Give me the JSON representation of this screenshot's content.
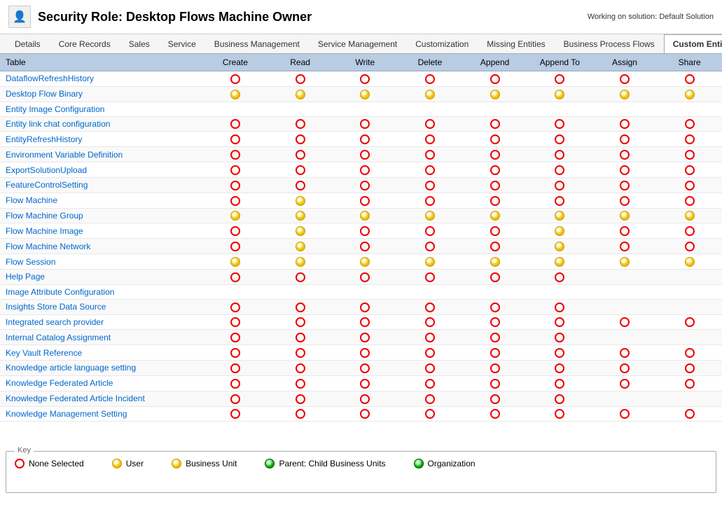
{
  "title": "Security Role: Desktop Flows Machine Owner",
  "working_on": "Working on solution: Default Solution",
  "tabs": [
    {
      "label": "Details",
      "active": false
    },
    {
      "label": "Core Records",
      "active": false
    },
    {
      "label": "Sales",
      "active": false
    },
    {
      "label": "Service",
      "active": false
    },
    {
      "label": "Business Management",
      "active": false
    },
    {
      "label": "Service Management",
      "active": false
    },
    {
      "label": "Customization",
      "active": false
    },
    {
      "label": "Missing Entities",
      "active": false
    },
    {
      "label": "Business Process Flows",
      "active": false
    },
    {
      "label": "Custom Entities",
      "active": true
    }
  ],
  "columns": [
    "Table",
    "Create",
    "Read",
    "Write",
    "Delete",
    "Append",
    "Append To",
    "Assign",
    "Share"
  ],
  "rows": [
    {
      "name": "DataflowRefreshHistory",
      "link": true,
      "cells": [
        "none",
        "none",
        "none",
        "none",
        "none",
        "none",
        "none",
        "none"
      ]
    },
    {
      "name": "Desktop Flow Binary",
      "link": true,
      "cells": [
        "user",
        "user",
        "user",
        "user",
        "user",
        "user",
        "user",
        "user"
      ]
    },
    {
      "name": "Entity Image Configuration",
      "link": true,
      "cells": [
        null,
        null,
        null,
        null,
        null,
        null,
        null,
        null
      ]
    },
    {
      "name": "Entity link chat configuration",
      "link": true,
      "cells": [
        "none",
        "none",
        "none",
        "none",
        "none",
        "none",
        "none",
        "none"
      ]
    },
    {
      "name": "EntityRefreshHistory",
      "link": true,
      "cells": [
        "none",
        "none",
        "none",
        "none",
        "none",
        "none",
        "none",
        "none"
      ]
    },
    {
      "name": "Environment Variable Definition",
      "link": true,
      "cells": [
        "none",
        "none",
        "none",
        "none",
        "none",
        "none",
        "none",
        "none"
      ]
    },
    {
      "name": "ExportSolutionUpload",
      "link": true,
      "cells": [
        "none",
        "none",
        "none",
        "none",
        "none",
        "none",
        "none",
        "none"
      ]
    },
    {
      "name": "FeatureControlSetting",
      "link": true,
      "cells": [
        "none",
        "none",
        "none",
        "none",
        "none",
        "none",
        "none",
        "none"
      ]
    },
    {
      "name": "Flow Machine",
      "link": true,
      "cells": [
        "none",
        "user",
        "none",
        "none",
        "none",
        "none",
        "none",
        "none"
      ]
    },
    {
      "name": "Flow Machine Group",
      "link": true,
      "cells": [
        "user",
        "user",
        "user",
        "user",
        "user",
        "user",
        "user",
        "user"
      ]
    },
    {
      "name": "Flow Machine Image",
      "link": true,
      "cells": [
        "none",
        "user",
        "none",
        "none",
        "none",
        "user",
        "none",
        "none"
      ]
    },
    {
      "name": "Flow Machine Network",
      "link": true,
      "cells": [
        "none",
        "user",
        "none",
        "none",
        "none",
        "user",
        "none",
        "none"
      ]
    },
    {
      "name": "Flow Session",
      "link": true,
      "cells": [
        "user",
        "user",
        "user",
        "user",
        "user",
        "user",
        "user",
        "user"
      ]
    },
    {
      "name": "Help Page",
      "link": true,
      "cells": [
        "none",
        "none",
        "none",
        "none",
        "none",
        "none",
        null,
        null
      ]
    },
    {
      "name": "Image Attribute Configuration",
      "link": true,
      "cells": [
        null,
        null,
        null,
        null,
        null,
        null,
        null,
        null
      ]
    },
    {
      "name": "Insights Store Data Source",
      "link": true,
      "cells": [
        "none",
        "none",
        "none",
        "none",
        "none",
        "none",
        null,
        null
      ]
    },
    {
      "name": "Integrated search provider",
      "link": true,
      "cells": [
        "none",
        "none",
        "none",
        "none",
        "none",
        "none",
        "none",
        "none"
      ]
    },
    {
      "name": "Internal Catalog Assignment",
      "link": true,
      "cells": [
        "none",
        "none",
        "none",
        "none",
        "none",
        "none",
        null,
        null
      ]
    },
    {
      "name": "Key Vault Reference",
      "link": true,
      "cells": [
        "none",
        "none",
        "none",
        "none",
        "none",
        "none",
        "none",
        "none"
      ]
    },
    {
      "name": "Knowledge article language setting",
      "link": true,
      "cells": [
        "none",
        "none",
        "none",
        "none",
        "none",
        "none",
        "none",
        "none"
      ]
    },
    {
      "name": "Knowledge Federated Article",
      "link": true,
      "cells": [
        "none",
        "none",
        "none",
        "none",
        "none",
        "none",
        "none",
        "none"
      ]
    },
    {
      "name": "Knowledge Federated Article Incident",
      "link": true,
      "cells": [
        "none",
        "none",
        "none",
        "none",
        "none",
        "none",
        null,
        null
      ]
    },
    {
      "name": "Knowledge Management Setting",
      "link": true,
      "cells": [
        "none",
        "none",
        "none",
        "none",
        "none",
        "none",
        "none",
        "none"
      ]
    }
  ],
  "key": {
    "title": "Key",
    "items": [
      {
        "label": "None Selected",
        "type": "none"
      },
      {
        "label": "User",
        "type": "user"
      },
      {
        "label": "Business Unit",
        "type": "bu"
      },
      {
        "label": "Parent: Child Business Units",
        "type": "org-partial"
      },
      {
        "label": "Organization",
        "type": "org"
      }
    ]
  }
}
